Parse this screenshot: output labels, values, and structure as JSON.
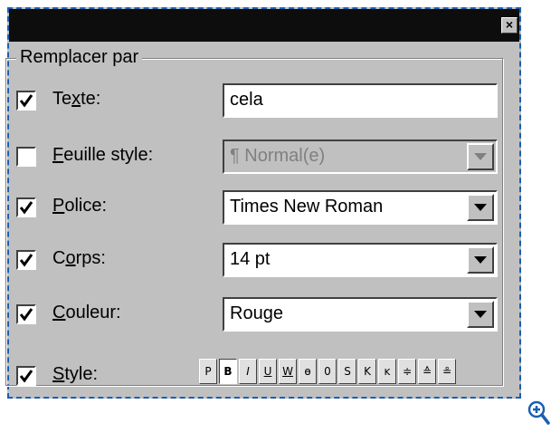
{
  "dialog": {
    "close_glyph": "×",
    "group_title": "Remplacer par"
  },
  "rows": {
    "texte": {
      "checked": true,
      "label_pre": "Te",
      "label_acc": "x",
      "label_post": "te:",
      "value": "cela"
    },
    "feuille": {
      "checked": false,
      "label_pre": "",
      "label_acc": "F",
      "label_post": "euille style:",
      "value": "¶ Normal(e)",
      "disabled": true
    },
    "police": {
      "checked": true,
      "label_pre": "",
      "label_acc": "P",
      "label_post": "olice:",
      "value": "Times New Roman"
    },
    "corps": {
      "checked": true,
      "label_pre": "C",
      "label_acc": "o",
      "label_post": "rps:",
      "value": "14 pt"
    },
    "couleur": {
      "checked": true,
      "label_pre": "",
      "label_acc": "C",
      "label_post": "ouleur:",
      "value": "Rouge"
    },
    "style": {
      "checked": true,
      "label_pre": "",
      "label_acc": "S",
      "label_post": "tyle:"
    }
  },
  "style_buttons": [
    {
      "glyph": "P",
      "active": false
    },
    {
      "glyph": "B",
      "active": true
    },
    {
      "glyph": "I",
      "active": false
    },
    {
      "glyph": "U",
      "active": false
    },
    {
      "glyph": "W",
      "active": false
    },
    {
      "glyph": "ɵ",
      "active": false
    },
    {
      "glyph": "0",
      "active": false
    },
    {
      "glyph": "S",
      "active": false
    },
    {
      "glyph": "K",
      "active": false
    },
    {
      "glyph": "ᴋ",
      "active": false
    },
    {
      "glyph": "≑",
      "active": false
    },
    {
      "glyph": "≙",
      "active": false
    },
    {
      "glyph": "≗",
      "active": false
    }
  ],
  "zoom_icon": "zoom-in-icon"
}
